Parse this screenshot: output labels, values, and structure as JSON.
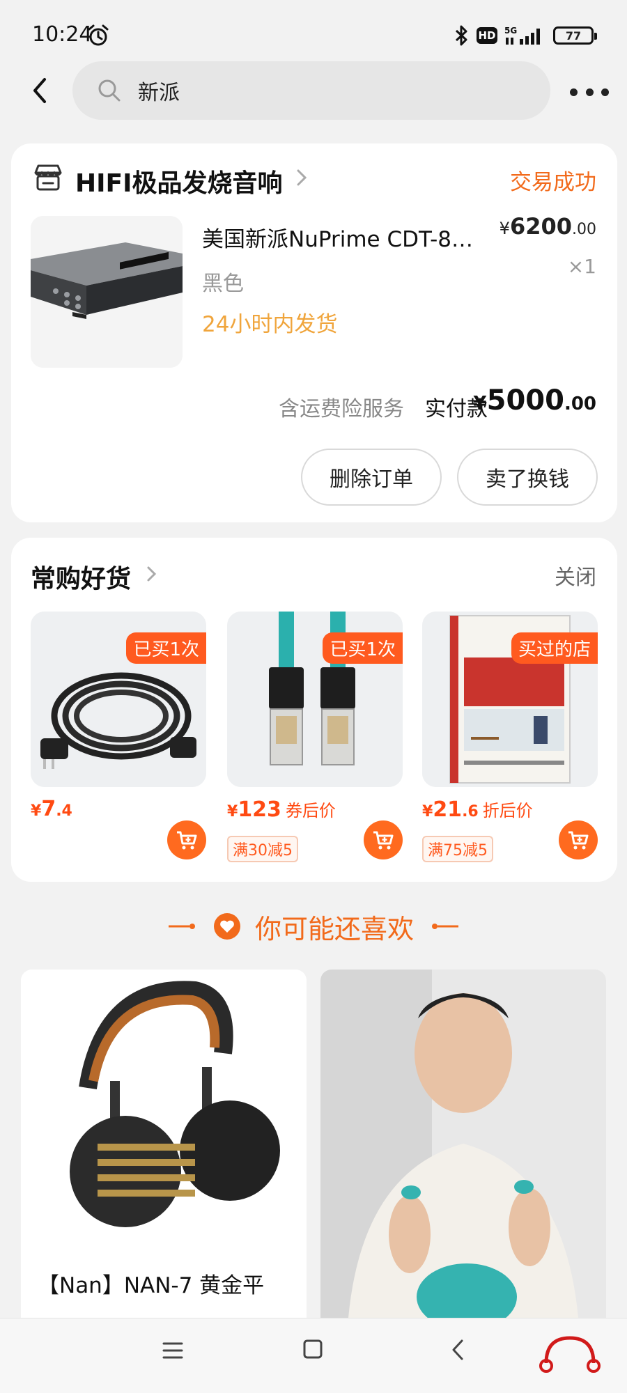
{
  "status_bar": {
    "time": "10:24",
    "network": "5G",
    "hd": "HD",
    "battery": "77"
  },
  "search": {
    "query": "新派"
  },
  "order": {
    "shop_name": "HIFI极品发烧音响",
    "status": "交易成功",
    "product_title": "美国新派NuPrime CDT-8…",
    "price": {
      "currency": "¥",
      "integer": "6200",
      "decimal": ".00"
    },
    "quantity": "×1",
    "variant": "黑色",
    "shipping": "24小时内发货",
    "insurance_label": "含运费险服务",
    "paid_label": "实付款",
    "paid": {
      "currency": "¥",
      "integer": "5000",
      "decimal": ".00"
    },
    "delete_label": "删除订单",
    "sell_label": "卖了换钱"
  },
  "favorites": {
    "title": "常购好货",
    "close_label": "关闭",
    "items": [
      {
        "badge": "已买1次",
        "price_currency": "¥",
        "price_int": "7",
        "price_dec": ".4",
        "suffix": "",
        "promo": ""
      },
      {
        "badge": "已买1次",
        "price_currency": "¥",
        "price_int": "123",
        "price_dec": "",
        "suffix": "券后价",
        "promo": "满30减5"
      },
      {
        "badge": "买过的店",
        "price_currency": "¥",
        "price_int": "21",
        "price_dec": ".6",
        "suffix": "折后价",
        "promo": "满75减5"
      }
    ]
  },
  "recommend": {
    "title": "你可能还喜欢",
    "items": [
      {
        "name": "【Nan】NAN-7 黄金平"
      }
    ]
  },
  "colors": {
    "accent": "#f26a1b",
    "price_red": "#ff4a12",
    "shipping_orange": "#f0a53c",
    "background": "#f2f2f2"
  },
  "icons": [
    "alarm-icon",
    "bluetooth-icon",
    "signal-icon",
    "battery-icon",
    "back-arrow-icon",
    "search-icon",
    "more-icon",
    "shop-icon",
    "chevron-right-icon",
    "cart-icon",
    "heart-icon",
    "menu-icon",
    "home-icon",
    "back-icon",
    "headphone-logo-icon"
  ]
}
